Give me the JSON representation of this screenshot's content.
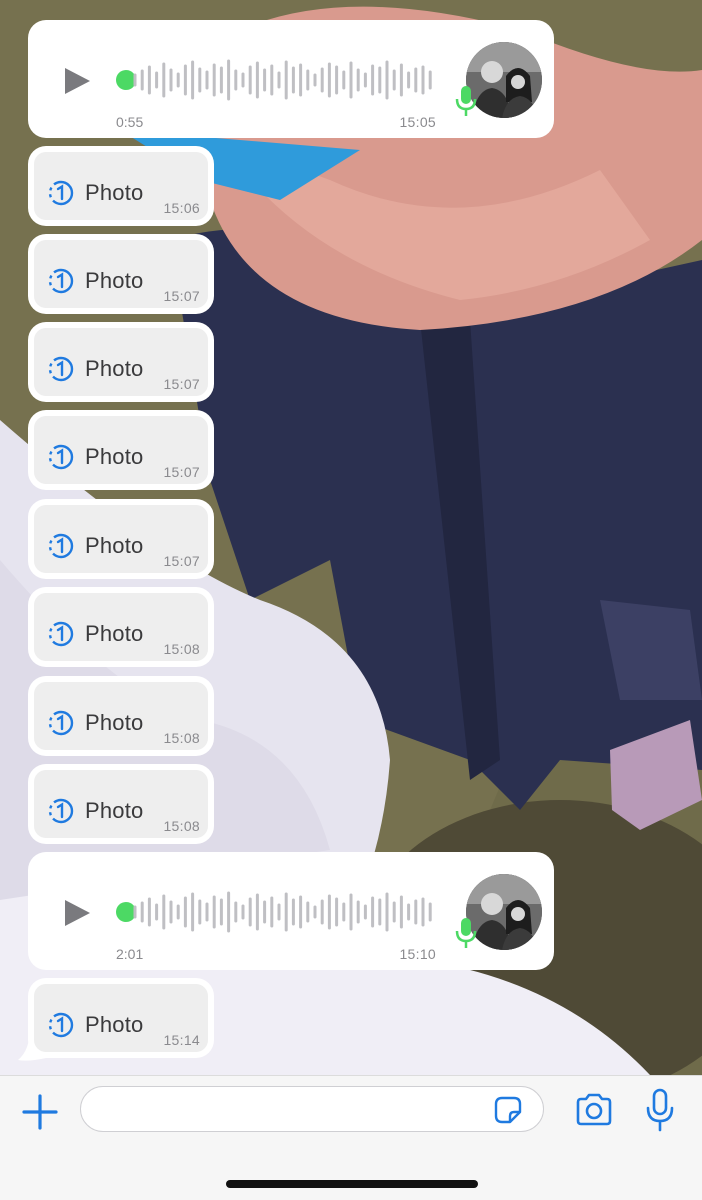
{
  "colors": {
    "accent_blue": "#1f7ae0",
    "online_green": "#4cd964",
    "bubble": "#ffffff",
    "photo_inner": "#eeeeee",
    "meta_text": "#8a8a8e"
  },
  "messages": [
    {
      "type": "voice",
      "duration": "0:55",
      "time": "15:05"
    },
    {
      "type": "photo",
      "label": "Photo",
      "time": "15:06"
    },
    {
      "type": "photo",
      "label": "Photo",
      "time": "15:07"
    },
    {
      "type": "photo",
      "label": "Photo",
      "time": "15:07"
    },
    {
      "type": "photo",
      "label": "Photo",
      "time": "15:07"
    },
    {
      "type": "photo",
      "label": "Photo",
      "time": "15:07"
    },
    {
      "type": "photo",
      "label": "Photo",
      "time": "15:08"
    },
    {
      "type": "photo",
      "label": "Photo",
      "time": "15:08"
    },
    {
      "type": "photo",
      "label": "Photo",
      "time": "15:08"
    },
    {
      "type": "voice",
      "duration": "2:01",
      "time": "15:10"
    },
    {
      "type": "photo",
      "label": "Photo",
      "time": "15:14"
    }
  ],
  "input_bar": {
    "message_placeholder": "",
    "icons": [
      "plus-icon",
      "sticker-icon",
      "camera-icon",
      "microphone-icon"
    ]
  }
}
